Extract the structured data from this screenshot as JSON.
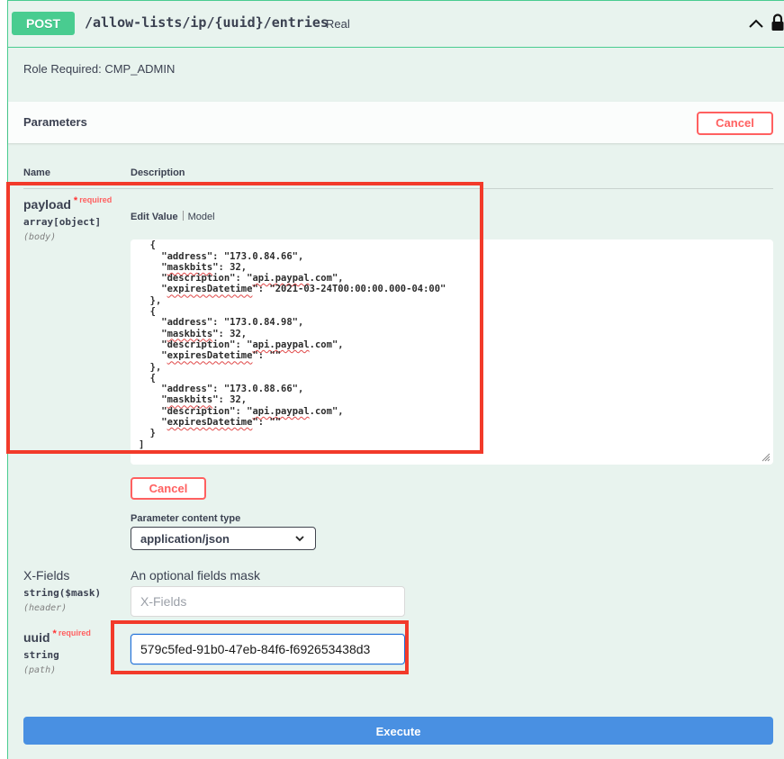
{
  "operation": {
    "method": "POST",
    "path": "/allow-lists/ip/{uuid}/entries",
    "summary": "Real",
    "role_text": "Role Required: CMP_ADMIN"
  },
  "parameters_section": {
    "title": "Parameters",
    "cancel_label": "Cancel",
    "col_name": "Name",
    "col_description": "Description"
  },
  "payload_param": {
    "name": "payload",
    "required_star": "*",
    "required_label": "required",
    "type": "array[object]",
    "in": "(body)",
    "tab_edit": "Edit Value",
    "tab_model": "Model",
    "body_lines": [
      "  },",
      "  {",
      "    \"address\": \"173.0.84.66\",",
      "    \"maskbits\": 32,",
      "    \"description\": \"api.paypal.com\",",
      "    \"expiresDatetime\": \"2021-03-24T00:00:00.000-04:00\"",
      "  },",
      "  {",
      "    \"address\": \"173.0.84.98\",",
      "    \"maskbits\": 32,",
      "    \"description\": \"api.paypal.com\",",
      "    \"expiresDatetime\": \"\"",
      "  },",
      "  {",
      "    \"address\": \"173.0.88.66\",",
      "    \"maskbits\": 32,",
      "    \"description\": \"api.paypal.com\",",
      "    \"expiresDatetime\": \"\"",
      "  }",
      "]"
    ],
    "cancel_label": "Cancel",
    "content_type_label": "Parameter content type",
    "content_type_value": "application/json"
  },
  "xfields_param": {
    "name": "X-Fields",
    "type": "string($mask)",
    "in": "(header)",
    "description": "An optional fields mask",
    "placeholder": "X-Fields"
  },
  "uuid_param": {
    "name": "uuid",
    "required_star": "*",
    "required_label": "required",
    "type": "string",
    "in": "(path)",
    "value": "579c5fed-91b0-47eb-84f6-f692653438d3"
  },
  "execute_label": "Execute",
  "colors": {
    "post_green": "#49cc90",
    "panel_bg": "#e8f3ee",
    "cancel_red": "#ff6060",
    "execute_blue": "#4990e2",
    "highlight_red": "#f23a2a"
  },
  "icons": {
    "collapse": "chevron-up-icon",
    "auth": "lock-icon",
    "select_caret": "chevron-down-icon",
    "resize": "resize-handle-icon"
  }
}
